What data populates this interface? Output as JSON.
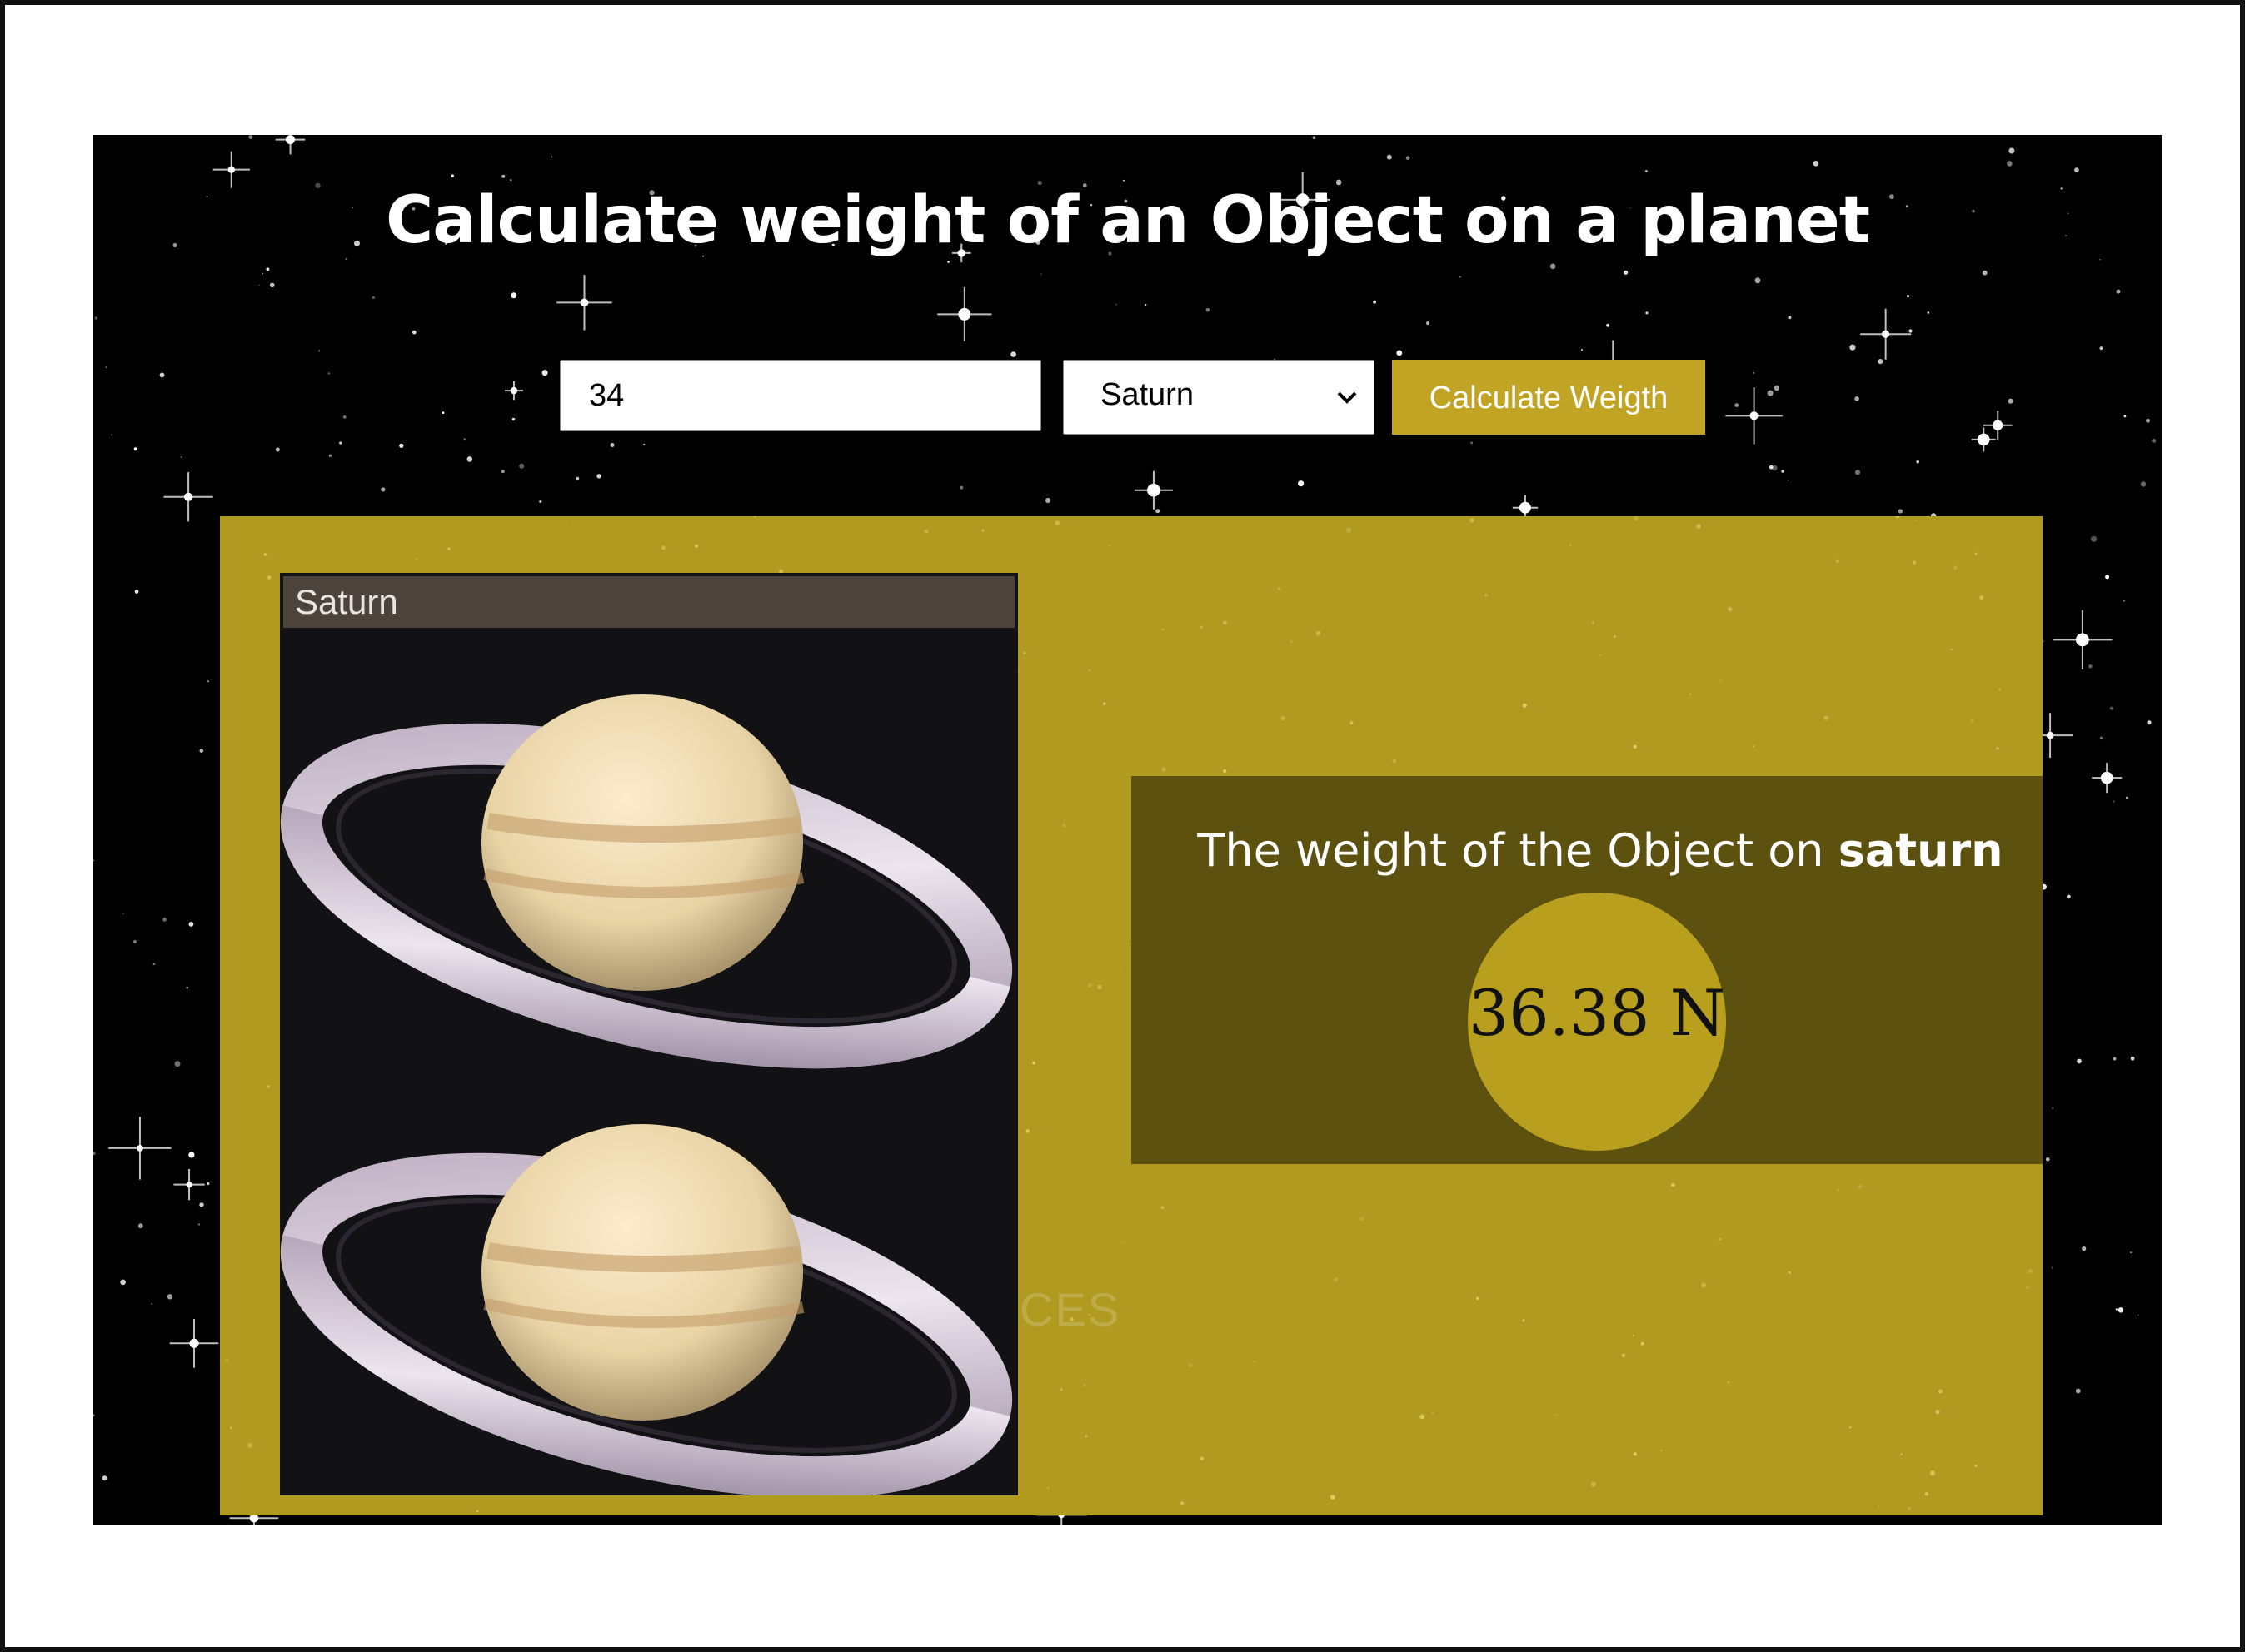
{
  "page": {
    "title": "Calculate weight of an Object on a planet"
  },
  "form": {
    "mass_value": "34",
    "planet_selected": "Saturn",
    "calculate_label": "Calculate Weigth"
  },
  "result": {
    "image_caption": "Saturn",
    "sentence_prefix": "The weight of the Object on",
    "planet_name": "saturn",
    "weight_value": "36.38 N",
    "background_text": "CES"
  },
  "colors": {
    "accent_gold": "#c2a424",
    "panel_gold": "#b09a20",
    "result_box": "#5d510f",
    "circle": "#b8a01e"
  },
  "icons": {
    "select_arrow": "chevron-down-icon",
    "planet_image": "saturn-icon"
  }
}
